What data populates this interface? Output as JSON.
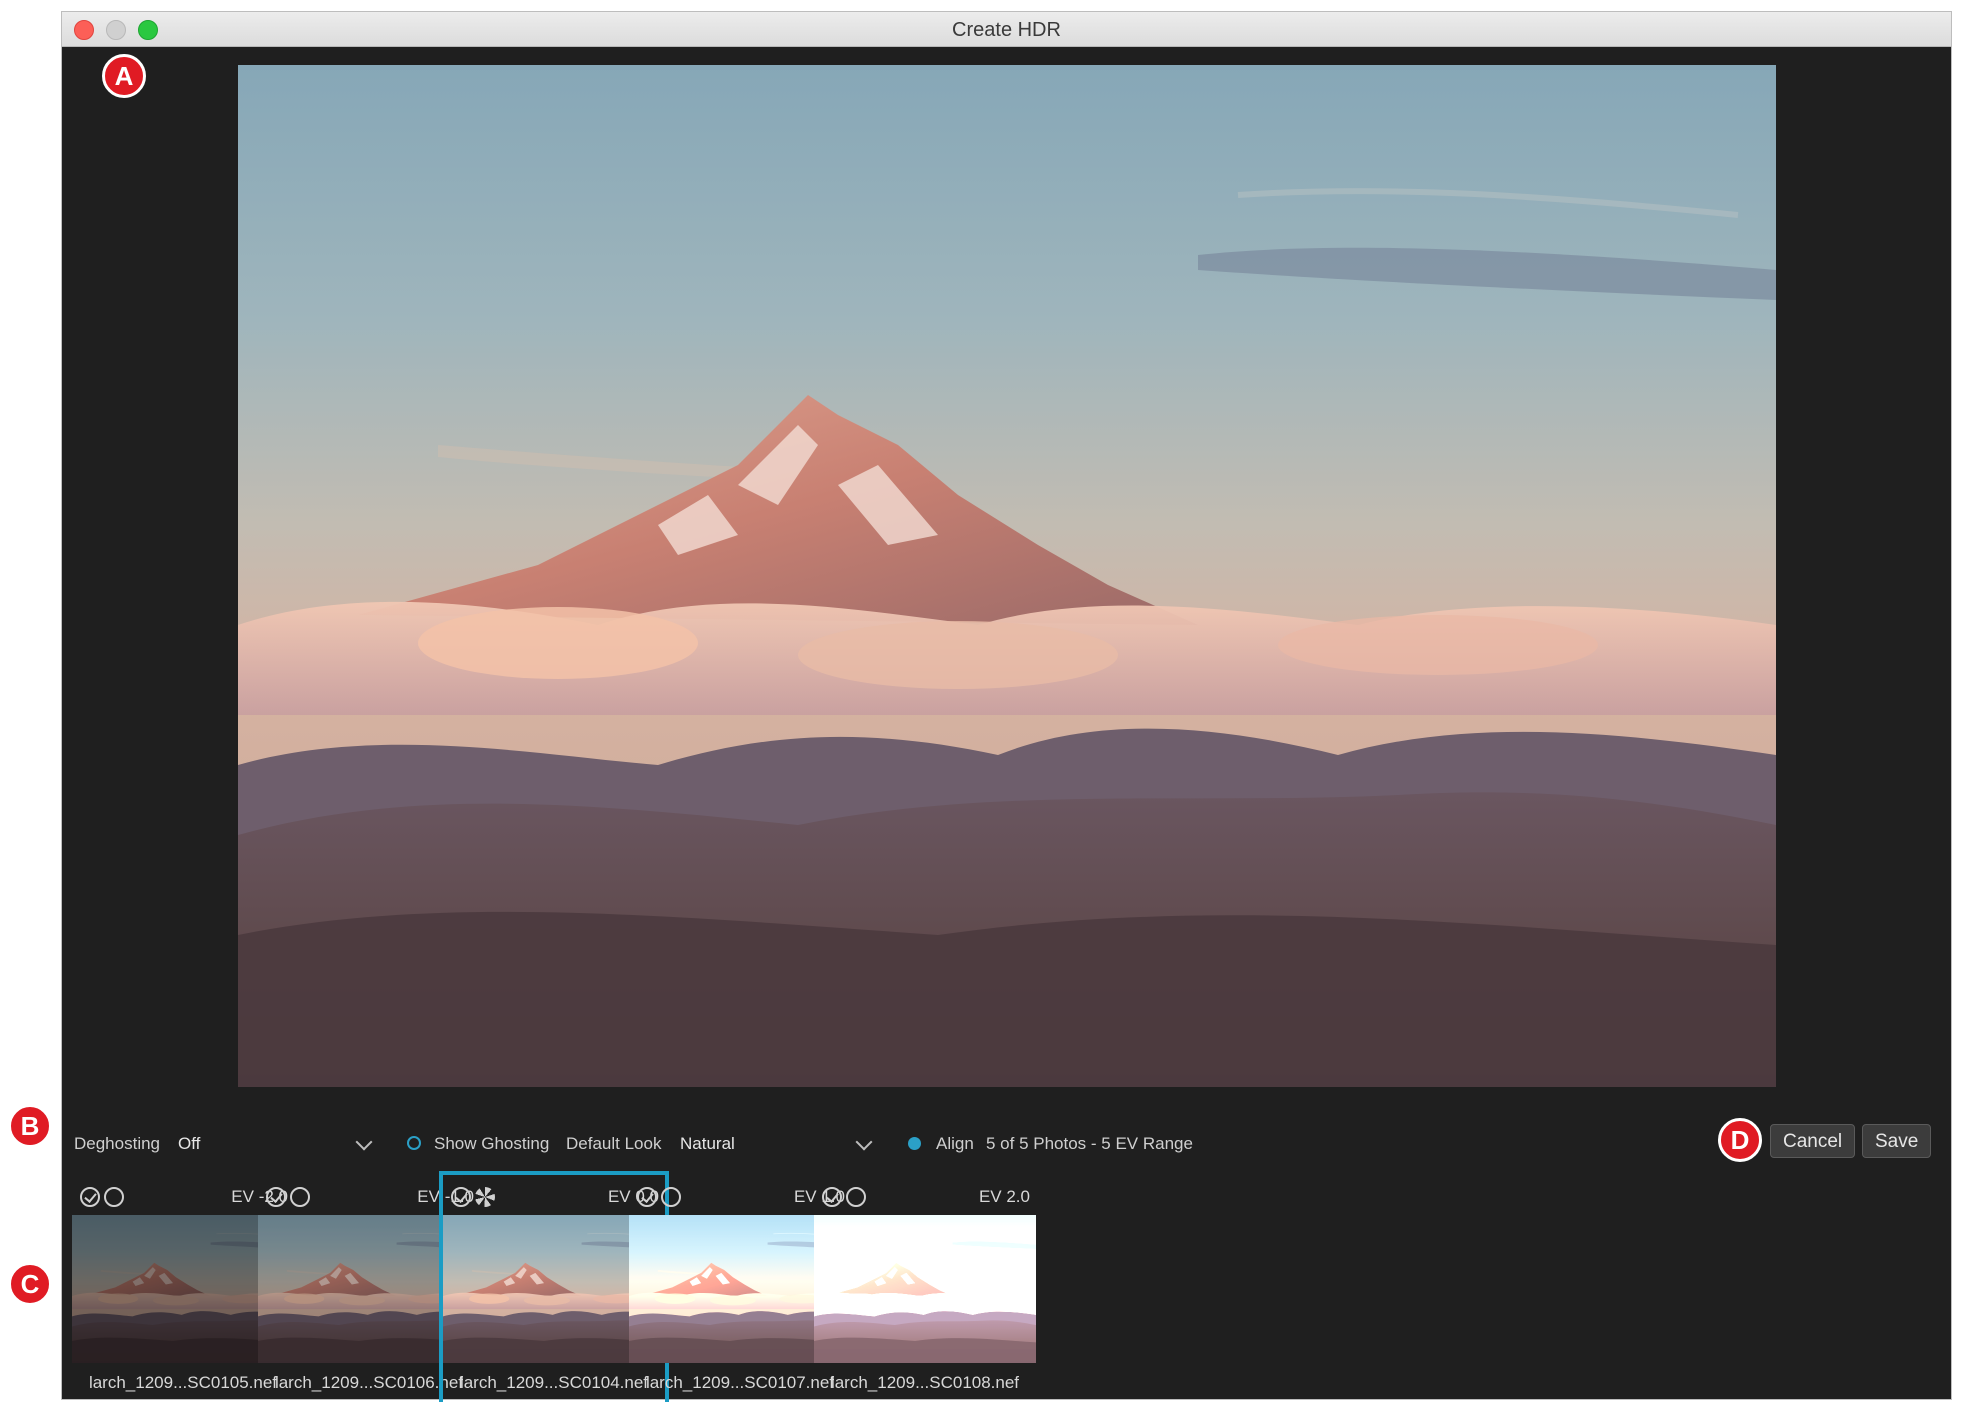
{
  "window": {
    "title": "Create HDR"
  },
  "badges": {
    "a": "A",
    "b": "B",
    "c": "C",
    "d": "D"
  },
  "controls": {
    "deghosting_label": "Deghosting",
    "deghosting_value": "Off",
    "show_ghosting_label": "Show Ghosting",
    "default_look_label": "Default Look",
    "default_look_value": "Natural",
    "align_label": "Align",
    "summary": "5 of 5 Photos - 5 EV Range"
  },
  "buttons": {
    "cancel": "Cancel",
    "save": "Save"
  },
  "thumbnails": [
    {
      "ev": "EV -2.0",
      "filename": "larch_1209...SC0105.nef",
      "brightness": 0.55,
      "selected": false,
      "reference": false
    },
    {
      "ev": "EV -1.0",
      "filename": "larch_1209...SC0106.nef",
      "brightness": 0.75,
      "selected": false,
      "reference": false
    },
    {
      "ev": "EV 0.0",
      "filename": "larch_1209...SC0104.nef",
      "brightness": 1.0,
      "selected": true,
      "reference": true
    },
    {
      "ev": "EV 1.0",
      "filename": "larch_1209...SC0107.nef",
      "brightness": 1.35,
      "selected": false,
      "reference": false
    },
    {
      "ev": "EV 2.0",
      "filename": "larch_1209...SC0108.nef",
      "brightness": 1.8,
      "selected": false,
      "reference": false
    }
  ],
  "colors": {
    "accent": "#1b9cc4",
    "badge": "#e01b24",
    "window_bg": "#1f1f1f"
  }
}
